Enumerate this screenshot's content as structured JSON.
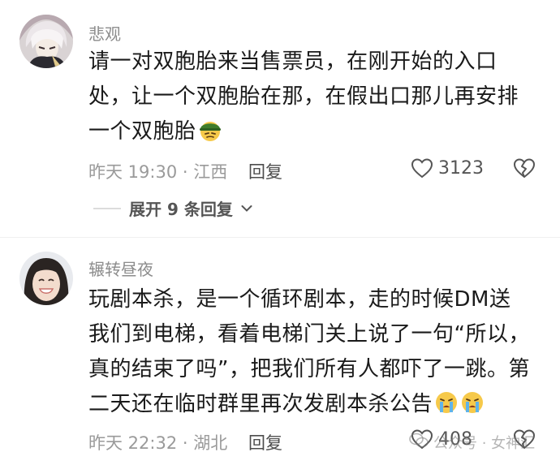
{
  "comments": [
    {
      "username": "悲观",
      "text": "请一对双胞胎来当售票员，在刚开始的入口处，让一个双胞胎在那，在假出口那儿再安排一个双胞胎",
      "emoji": "soldier-face-emoji",
      "time_location": "昨天 19:30 · 江西",
      "reply_label": "回复",
      "like_count": "3123",
      "expand_label": "展开 9 条回复"
    },
    {
      "username": "辗转昼夜",
      "text": "玩剧本杀，是一个循环剧本，走的时候DM送我们到电梯，看着电梯门关上说了一句“所以，真的结束了吗”，把我们所有人都吓了一跳。第二天还在临时群里再次发剧本杀公告",
      "emoji": "crying-face-emoji",
      "time_location": "昨天 22:32 · 湖北",
      "reply_label": "回复",
      "like_count": "408"
    }
  ],
  "watermark": {
    "text": "公众号 · 女神汇"
  },
  "colors": {
    "meta_gray": "#9a9a9a",
    "text": "#1a1a1a",
    "divider": "#f0f0f0"
  }
}
